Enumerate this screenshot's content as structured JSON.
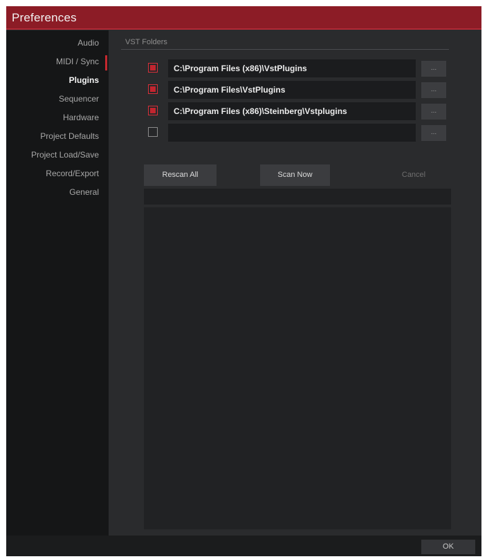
{
  "window": {
    "title": "Preferences"
  },
  "sidebar": {
    "items": [
      {
        "label": "Audio"
      },
      {
        "label": "MIDI / Sync"
      },
      {
        "label": "Plugins",
        "active": true
      },
      {
        "label": "Sequencer"
      },
      {
        "label": "Hardware"
      },
      {
        "label": "Project Defaults"
      },
      {
        "label": "Project Load/Save"
      },
      {
        "label": "Record/Export"
      },
      {
        "label": "General"
      }
    ]
  },
  "main": {
    "section_label": "VST Folders",
    "folders": [
      {
        "checked": true,
        "path": "C:\\Program Files (x86)\\VstPlugins",
        "browse_label": "..."
      },
      {
        "checked": true,
        "path": "C:\\Program Files\\VstPlugins",
        "browse_label": "..."
      },
      {
        "checked": true,
        "path": "C:\\Program Files (x86)\\Steinberg\\Vstplugins",
        "browse_label": "..."
      },
      {
        "checked": false,
        "path": "",
        "browse_label": "..."
      }
    ],
    "buttons": {
      "rescan_all": "Rescan All",
      "scan_now": "Scan Now",
      "cancel": "Cancel"
    }
  },
  "footer": {
    "ok_label": "OK"
  },
  "colors": {
    "accent": "#8c1c26",
    "checkbox_red": "#c2252f",
    "sidebar_bg": "#151617",
    "panel_bg": "#2a2b2d"
  }
}
